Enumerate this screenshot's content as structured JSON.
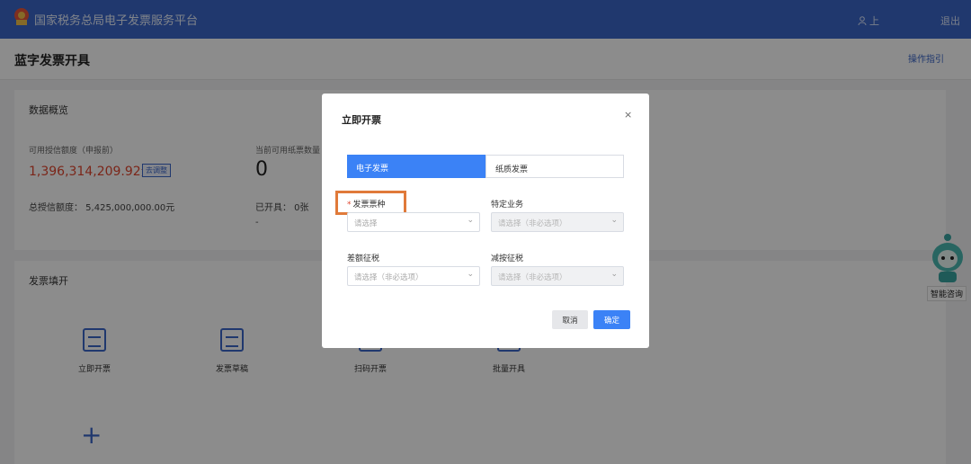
{
  "header": {
    "brand": "国家税务总局电子发票服务平台",
    "user": "上",
    "exit": "退出"
  },
  "page": {
    "title": "蓝字发票开具",
    "guide": "操作指引"
  },
  "overview": {
    "title": "数据概览",
    "credit_label": "可用授信额度（申报前）",
    "credit_value": "1,396,314,209.92元",
    "adjust_tag": "去调整",
    "paper_label": "当前可用纸票数量",
    "paper_value": "0",
    "total_credit": "总授信额度：  5,425,000,000.00元",
    "issued": "已开具：  0张",
    "dash": "-"
  },
  "invoice": {
    "title": "发票填开",
    "tiles": [
      "立即开票",
      "发票草稿",
      "扫码开票",
      "批量开具"
    ],
    "plus": "+"
  },
  "robot": {
    "label": "智能咨询"
  },
  "modal": {
    "title": "立即开票",
    "close": "×",
    "tab_electronic": "电子发票",
    "tab_paper": "纸质发票",
    "f1_label": "发票票种",
    "f1_placeholder": "请选择",
    "f2_label": "特定业务",
    "f2_placeholder": "请选择（非必选项）",
    "f3_label": "差额征税",
    "f3_placeholder": "请选择（非必选项）",
    "f4_label": "减按征税",
    "f4_placeholder": "请选择（非必选项）",
    "req_mark": "*",
    "cancel": "取消",
    "confirm": "确定",
    "chevron": "⌄"
  },
  "colors": {
    "primary": "#3b82f6",
    "topbar": "#3b67c8",
    "credit": "#e0462f",
    "highlight": "#e07a3a"
  }
}
